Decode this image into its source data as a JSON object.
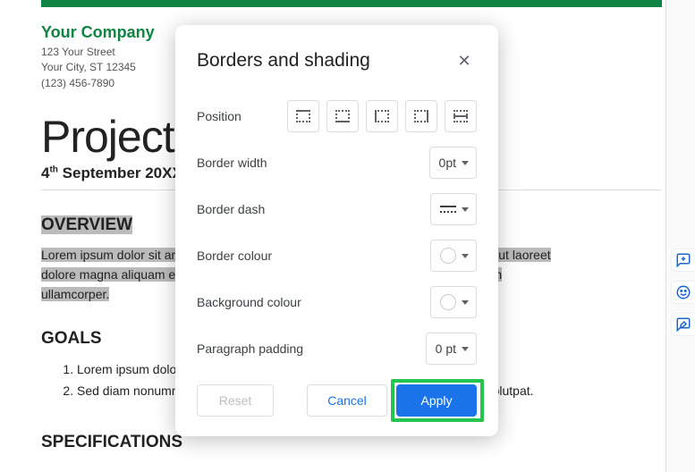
{
  "doc": {
    "company_name": "Your Company",
    "addr1": "123 Your Street",
    "addr2": "Your City, ST 12345",
    "phone": "(123) 456-7890",
    "title": "Project Name",
    "date_prefix": "4",
    "date_suffix": "th",
    "date_rest": " September 20XX",
    "overview_h": "OVERVIEW",
    "overview_txt": "Lorem ipsum dolor sit amet, consectetuer adipiscing elit, sed do euismod tincidunt ut laoreet dolore magna aliquam erat volutpat. Ut wisi enim veniam, quis nostrud exerci tation ullamcorper.",
    "goals_h": "GOALS",
    "goals": [
      "Lorem ipsum dolor sit amet, consectetuer adipiscing elit.",
      "Sed diam nonummy nibh euismod tincidunt ut laoreet dolore aliquam erat volutpat."
    ],
    "spec_h": "SPECIFICATIONS"
  },
  "dialog": {
    "title": "Borders and shading",
    "rows": {
      "position": "Position",
      "width": "Border width",
      "dash": "Border dash",
      "colour": "Border colour",
      "bg": "Background colour",
      "padding": "Paragraph padding"
    },
    "width_val": "0pt",
    "padding_val": "0 pt",
    "reset": "Reset",
    "cancel": "Cancel",
    "apply": "Apply"
  }
}
